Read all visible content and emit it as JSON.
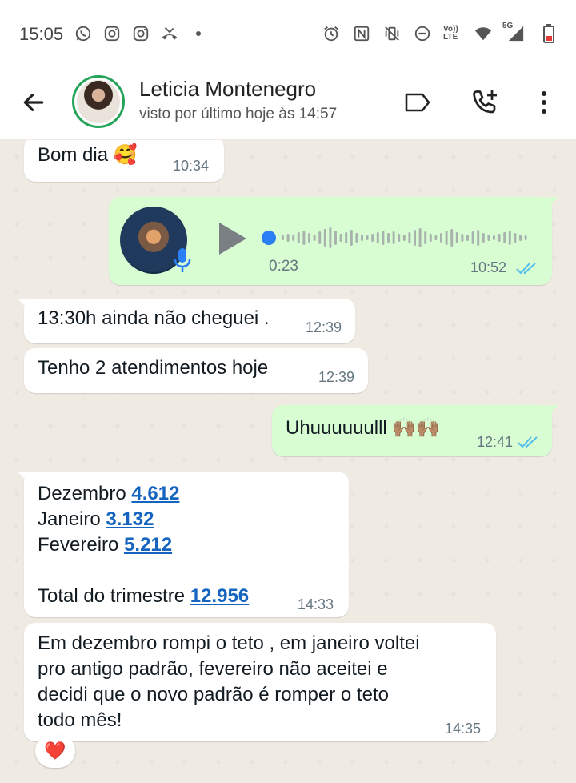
{
  "status_bar": {
    "time": "15:05",
    "left_icons": [
      "whatsapp-icon",
      "instagram-icon",
      "instagram-icon",
      "missed-call-icon",
      "dot-icon"
    ],
    "right_icons": [
      "alarm-icon",
      "nfc-icon",
      "vibrate-icon",
      "do-not-disturb-icon",
      "volte-icon",
      "wifi-icon",
      "signal-5g-icon",
      "battery-icon"
    ],
    "volte_label": "Vo)) LTE",
    "network_label": "5G"
  },
  "header": {
    "contact_name": "Leticia Montenegro",
    "last_seen": "visto por último hoje às 14:57",
    "icons": [
      "back-arrow-icon",
      "label-icon",
      "add-call-icon",
      "more-vert-icon"
    ]
  },
  "messages": [
    {
      "id": "m1",
      "direction": "in",
      "text": "Bom dia 🥰",
      "time": "10:34"
    },
    {
      "id": "m2",
      "direction": "out",
      "type": "audio",
      "duration": "0:23",
      "time": "10:52",
      "read": true
    },
    {
      "id": "m3",
      "direction": "in",
      "text": "13:30h ainda não cheguei .",
      "time": "12:39"
    },
    {
      "id": "m4",
      "direction": "in",
      "text": "Tenho 2 atendimentos hoje",
      "time": "12:39"
    },
    {
      "id": "m5",
      "direction": "out",
      "text": "Uhuuuuuulll 🙌🏽🙌🏽",
      "time": "12:41",
      "read": true
    },
    {
      "id": "m6",
      "direction": "in",
      "time": "14:33",
      "lines": [
        {
          "label": "Dezembro ",
          "value": "4.612"
        },
        {
          "label": "Janeiro ",
          "value": "3.132"
        },
        {
          "label": "Fevereiro ",
          "value": "5.212"
        },
        {
          "label": "Total do trimestre ",
          "value": "12.956"
        }
      ]
    },
    {
      "id": "m7",
      "direction": "in",
      "time": "14:35",
      "lines": [
        "Em dezembro rompi o teto , em janeiro voltei",
        "pro antigo padrão, fevereiro não aceitei e",
        "decidi que o novo padrão é romper o teto",
        "todo mês!"
      ],
      "reaction": "❤️"
    }
  ],
  "colors": {
    "incoming_bubble": "#ffffff",
    "outgoing_bubble": "#d9fdd3",
    "read_ticks": "#53bdeb",
    "link": "#1565c0",
    "avatar_ring": "#25a35a"
  }
}
